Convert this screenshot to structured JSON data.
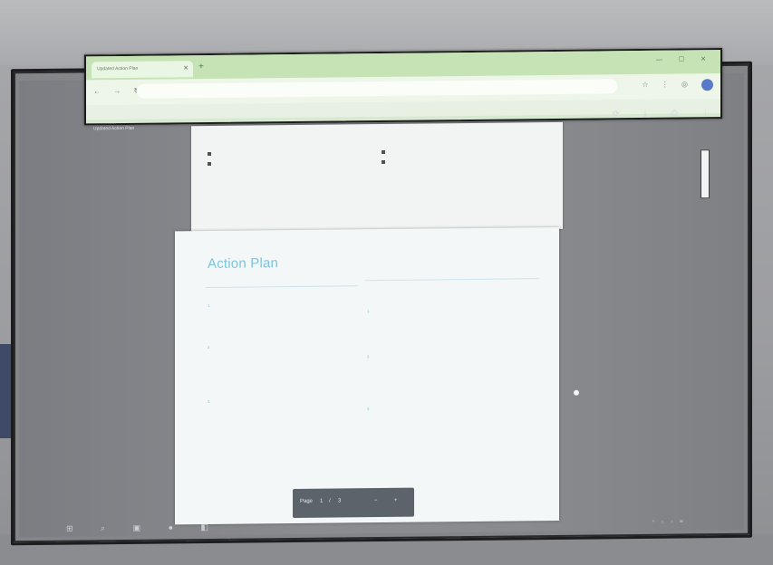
{
  "browser": {
    "tab_title": "Updated Action Plan",
    "new_tab_symbol": "+",
    "window_buttons": "— ☐ ✕",
    "nav_icons": "← → ↻",
    "address": "",
    "ext_icons": "☆ ⋮ ◎"
  },
  "pdf": {
    "file_chip": "Updated Action Plan",
    "right_tools": "⟳ ⤓ ⎙ ⋮"
  },
  "page1": {
    "top_label": "",
    "left_bullets": [
      "",
      "",
      "",
      ""
    ],
    "right_bullets": [
      "",
      "",
      ""
    ]
  },
  "page2": {
    "title": "Action Plan",
    "left_col_head": "",
    "right_col_head": "",
    "left_items": [
      {
        "num": "1.",
        "text": ""
      },
      {
        "num": "2.",
        "text": ""
      },
      {
        "num": "3.",
        "text": ""
      }
    ],
    "right_items": [
      {
        "num": "1.",
        "text": ""
      },
      {
        "num": "2.",
        "text": ""
      },
      {
        "num": "3.",
        "text": ""
      }
    ]
  },
  "page_nav": {
    "label": "Page",
    "current": "1",
    "sep": "/",
    "total": "3",
    "zoom_out": "−",
    "zoom_in": "+"
  },
  "taskbar": {
    "icons": "⊞ ⌕ ▣ ● ◧",
    "tray": "^ ⌂ ♪ ✉",
    "time": "",
    "date": ""
  },
  "colors": {
    "accent": "#7ec4de",
    "browser_green": "#c6e3b6"
  }
}
